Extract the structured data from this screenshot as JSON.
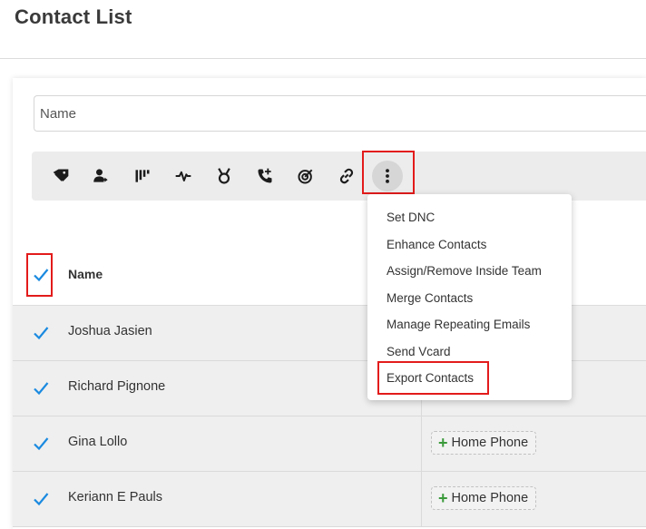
{
  "page": {
    "title": "Contact List"
  },
  "search": {
    "placeholder": "Name"
  },
  "toolbar": {
    "icons": [
      "tag-icon",
      "assign-user-icon",
      "pipeline-icon",
      "activity-icon",
      "award-icon",
      "call-icon",
      "target-icon",
      "link-icon",
      "more-vertical-icon"
    ]
  },
  "menu": {
    "items": [
      "Set DNC",
      "Enhance Contacts",
      "Assign/Remove Inside Team",
      "Merge Contacts",
      "Manage Repeating Emails",
      "Send Vcard",
      "Export Contacts"
    ]
  },
  "table": {
    "header": {
      "name": "Name"
    },
    "rows": [
      {
        "name": "Joshua Jasien",
        "phone": ""
      },
      {
        "name": "Richard Pignone",
        "phone": ""
      },
      {
        "name": "Gina Lollo",
        "phone": "Home Phone"
      },
      {
        "name": "Keriann E Pauls",
        "phone": "Home Phone"
      }
    ]
  },
  "colors": {
    "checkmark": "#1a8ae0",
    "highlight": "#e31b1b",
    "plus": "#3a9a3a"
  }
}
